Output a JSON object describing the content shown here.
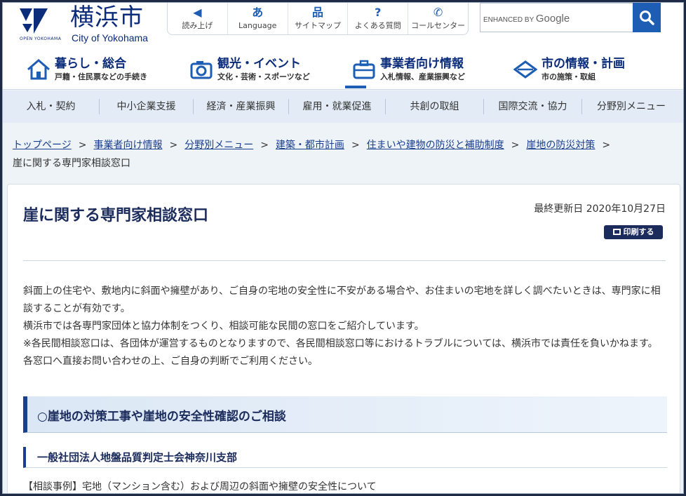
{
  "header": {
    "city_name": "横浜市",
    "city_sub": "City of Yokohama",
    "logo_text": "OPEN YOKOHAMA",
    "tools": [
      {
        "icon": "speaker-icon",
        "glyph": "◀",
        "label": "読み上げ"
      },
      {
        "icon": "language-icon",
        "glyph": "あ",
        "label": "Language"
      },
      {
        "icon": "sitemap-icon",
        "glyph": "品",
        "label": "サイトマップ"
      },
      {
        "icon": "question-icon",
        "glyph": "?",
        "label": "よくある質問"
      },
      {
        "icon": "phone-icon",
        "glyph": "✆",
        "label": "コールセンター"
      }
    ],
    "search": {
      "enhanced_by": "ENHANCED BY",
      "brand": "Google"
    }
  },
  "global_nav": [
    {
      "icon": "house-icon",
      "title": "暮らし・総合",
      "sub": "戸籍・住民票などの手続き"
    },
    {
      "icon": "camera-icon",
      "title": "観光・イベント",
      "sub": "文化・芸術・スポーツなど"
    },
    {
      "icon": "briefcase-icon",
      "title": "事業者向け情報",
      "sub": "入札情報、産業振興など",
      "active": true
    },
    {
      "icon": "diamond-icon",
      "title": "市の情報・計画",
      "sub": "市の施策・取組"
    }
  ],
  "sub_nav": [
    "入札・契約",
    "中小企業支援",
    "経済・産業振興",
    "雇用・就業促進",
    "共創の取組",
    "国際交流・協力",
    "分野別メニュー"
  ],
  "breadcrumb": {
    "links": [
      "トップページ",
      "事業者向け情報",
      "分野別メニュー",
      "建築・都市計画",
      "住まいや建物の防災と補助制度",
      "崖地の防災対策"
    ],
    "separator": ">",
    "current": "崖に関する専門家相談窓口"
  },
  "page": {
    "title": "崖に関する専門家相談窓口",
    "updated": "最終更新日 2020年10月27日",
    "print_label": "印刷する",
    "paragraphs": [
      "斜面上の住宅や、敷地内に斜面や擁壁があり、ご自身の宅地の安全性に不安がある場合や、お住まいの宅地を詳しく調べたいときは、専門家に相談することが有効です。",
      "横浜市では各専門家団体と協力体制をつくり、相談可能な民間の窓口をご紹介しています。",
      "※各民間相談窓口は、各団体が運営するものとなりますので、各民間相談窓口等におけるトラブルについては、横浜市では責任を負いかねます。",
      "各窓口へ直接お問い合わせの上、ご自身の判断でご利用ください。"
    ],
    "section_heading": "○崖地の対策工事や崖地の安全性確認のご相談",
    "sub_heading": "一般社団法人地盤品質判定士会神奈川支部",
    "case_text": "【相談事例】宅地（マンション含む）および周辺の斜面や擁壁の安全性について"
  },
  "colors": {
    "brand_navy": "#0a2c7a",
    "accent_blue": "#1d5db4",
    "heading_navy": "#1a2b5c",
    "subnav_bg": "#e3ecf6"
  }
}
